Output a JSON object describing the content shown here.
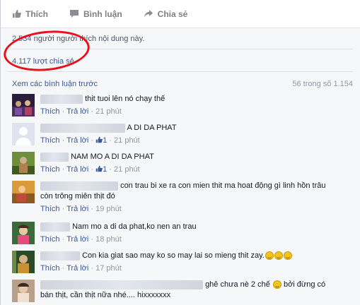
{
  "actions": {
    "like": "Thích",
    "comment": "Bình luận",
    "share": "Chia sẻ"
  },
  "stats": {
    "likes_count": "2.534",
    "likes_text": "người người thích nội dung này.",
    "shares": "4.117 lượt chia sẻ"
  },
  "previous": {
    "link": "Xem các bình luận trước",
    "count": "56 trong số 1.154"
  },
  "comments": [
    {
      "text": "thit tuoi lên nó chạy thế",
      "like": "Thích",
      "reply": "Trả lời",
      "time": "21 phút",
      "likes": ""
    },
    {
      "text": "A DI DA PHAT",
      "like": "Thích",
      "reply": "Trả lời",
      "time": "21 phút",
      "likes": "1"
    },
    {
      "text": "NAM MO A DI DA PHAT",
      "like": "Thích",
      "reply": "Trả lời",
      "time": "21 phút",
      "likes": "1"
    },
    {
      "text": "con trau bi xe ra con mien thit ma hoat động gì linh hồn trâu còn trông miên thịt đó",
      "like": "Thích",
      "reply": "Trả lời",
      "time": "19 phút",
      "likes": ""
    },
    {
      "text": "Nam mo a di da phat,ko nen an trau",
      "like": "Thích",
      "reply": "Trả lời",
      "time": "18 phút",
      "likes": ""
    },
    {
      "text": "Con kia giat sao may ko so may lai so mieng thit zay.",
      "like": "Thích",
      "reply": "Trả lời",
      "time": "17 phút",
      "likes": ""
    },
    {
      "text_a": "ghê chưa nè 2 chế",
      "text_b": "bởi đừng có",
      "text_c": "bán thịt, cần thịt nữa nhé.... hixxxxxxx"
    }
  ],
  "colors": {
    "link": "#3b5998",
    "muted": "#9197a3",
    "highlight": "#e8101b"
  }
}
